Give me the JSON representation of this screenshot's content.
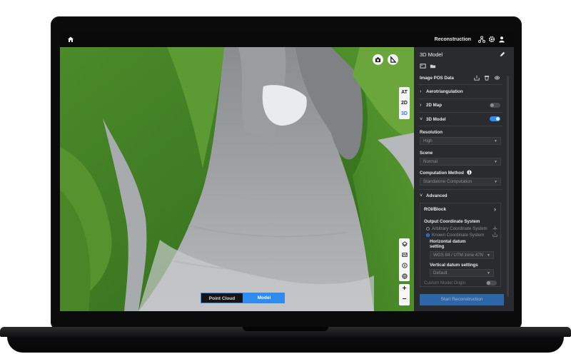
{
  "topbar": {
    "title": "Reconstruction"
  },
  "viewport": {
    "view_modes": [
      "AT",
      "2D",
      "3D"
    ],
    "active_view": "3D",
    "mode_toggle": {
      "point_cloud": "Point Cloud",
      "model": "Model",
      "active": "Model"
    },
    "zoom": {
      "in": "+",
      "out": "−"
    }
  },
  "panel": {
    "title": "3D Model",
    "image_pos_label": "Image POS Data",
    "sections": {
      "aerotriangulation": "Aerotriangulation",
      "map2d": "2D Map",
      "model3d": "3D Model",
      "map2d_enabled": false,
      "model3d_enabled": true
    },
    "resolution": {
      "label": "Resolution",
      "value": "High"
    },
    "scene": {
      "label": "Scene",
      "value": "Normal"
    },
    "computation": {
      "label": "Computation Method",
      "value": "Standalone Computation"
    },
    "advanced": "Advanced",
    "roi": {
      "title": "ROI/Block",
      "output_coord": "Output Coordinate System",
      "arbitrary": "Arbitrary Coordinate System",
      "known": "Known Coordinate System",
      "selected": "known",
      "horizontal_label": "Horizontal datum setting",
      "horizontal_value": "WGS 84 / UTM zone 47N",
      "vertical_label": "Vertical datum settings",
      "vertical_value": "Default",
      "custom_origin": "Custom Model Origin",
      "custom_origin_enabled": false
    },
    "start_button": "Start Reconstruction"
  },
  "colors": {
    "accent": "#2d8cf0",
    "panel_bg": "#2a2b2e",
    "topbar_bg": "#0a0a0b"
  }
}
